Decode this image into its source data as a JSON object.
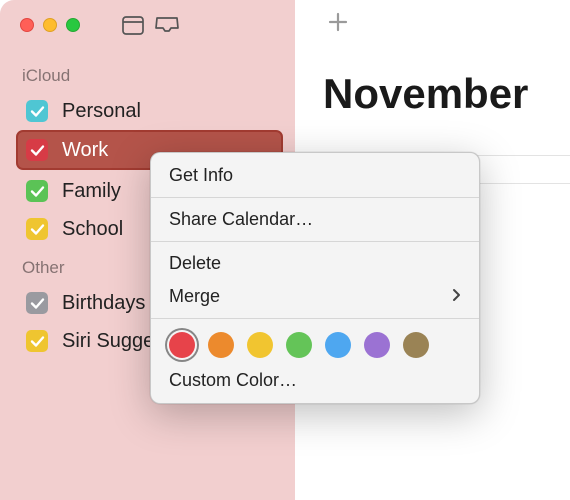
{
  "month": "November",
  "sidebar": {
    "sections": [
      {
        "label": "iCloud",
        "items": [
          {
            "label": "Personal",
            "color": "#4fc6d3",
            "selected": false
          },
          {
            "label": "Work",
            "color": "#d73b46",
            "selected": true
          },
          {
            "label": "Family",
            "color": "#5bc356",
            "selected": false
          },
          {
            "label": "School",
            "color": "#efc530",
            "selected": false
          }
        ]
      },
      {
        "label": "Other",
        "items": [
          {
            "label": "Birthdays",
            "color": "#9a9aa0",
            "selected": false
          },
          {
            "label": "Siri Suggestions",
            "color": "#efc530",
            "selected": false
          }
        ]
      }
    ]
  },
  "context_menu": {
    "items": {
      "get_info": "Get Info",
      "share": "Share Calendar…",
      "delete": "Delete",
      "merge": "Merge",
      "custom_color": "Custom Color…"
    },
    "colors": [
      {
        "hex": "#e7434a",
        "selected": true
      },
      {
        "hex": "#ec8a2d",
        "selected": false
      },
      {
        "hex": "#f1c530",
        "selected": false
      },
      {
        "hex": "#64c458",
        "selected": false
      },
      {
        "hex": "#4ea7f0",
        "selected": false
      },
      {
        "hex": "#9b72d3",
        "selected": false
      },
      {
        "hex": "#9a8355",
        "selected": false
      }
    ]
  }
}
